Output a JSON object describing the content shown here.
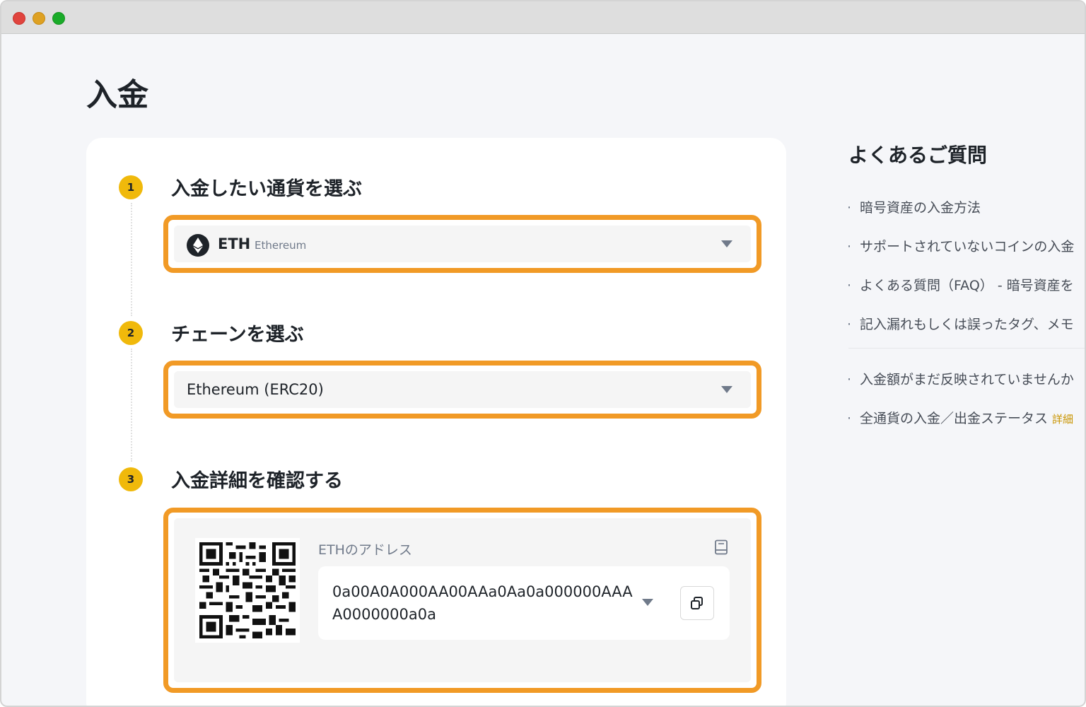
{
  "page": {
    "title": "入金"
  },
  "steps": [
    {
      "number": "1",
      "title": "入金したい通貨を選ぶ"
    },
    {
      "number": "2",
      "title": "チェーンを選ぶ"
    },
    {
      "number": "3",
      "title": "入金詳細を確認する"
    }
  ],
  "coin_select": {
    "symbol": "ETH",
    "name": "Ethereum",
    "icon": "ethereum-icon"
  },
  "chain_select": {
    "value": "Ethereum (ERC20)"
  },
  "deposit_details": {
    "address_label": "ETHのアドレス",
    "address": "0a00A0A000AA00AAa0Aa0a000000AAAA0000000a0a"
  },
  "faq": {
    "title": "よくあるご質問",
    "items": [
      "暗号資産の入金方法",
      "サポートされていないコインの入金",
      "よくある質問（FAQ） - 暗号資産を",
      "記入漏れもしくは誤ったタグ、メモ",
      "入金額がまだ反映されていませんか",
      "全通貨の入金／出金ステータス"
    ],
    "status_link": "詳細"
  },
  "colors": {
    "highlight": "#f19a26",
    "accent": "#f0b90b"
  }
}
